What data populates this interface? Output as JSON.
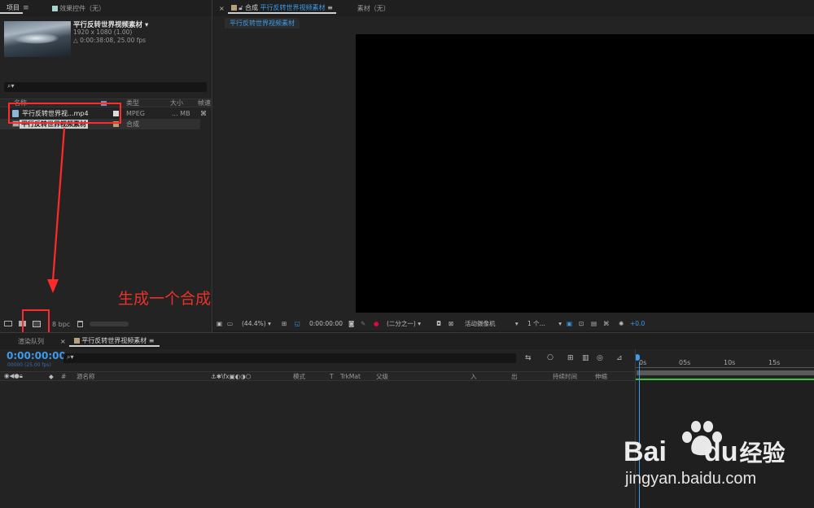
{
  "project_panel": {
    "tab_project": "项目",
    "tab_effects": "效果控件（无）",
    "asset": {
      "name": "平行反转世界视频素材",
      "resolution": "1920 x 1080 (1.00)",
      "duration": "△ 0:00:38:08, 25.00 fps"
    },
    "search_placeholder": "",
    "columns": {
      "name": "名称",
      "type": "类型",
      "size": "大小",
      "frame": "帧速"
    },
    "items": [
      {
        "name": "平行反转世界视...mp4",
        "type": "MPEG",
        "size": "... MB"
      },
      {
        "name": "平行反转世界视频素材",
        "type": "合成",
        "size": ""
      }
    ],
    "bpc": "8 bpc"
  },
  "annotation": {
    "text": "生成一个合成",
    "color": "#e8322a"
  },
  "viewer": {
    "tab_close": "×",
    "tab_comp_prefix": "合成",
    "tab_comp_name": "平行反转世界视频素材",
    "tab_footage": "素材（无）",
    "breadcrumb": "平行反转世界视频素材",
    "zoom": "(44.4%)",
    "timecode": "0:00:00:00",
    "resolution": "(二分之一)",
    "camera": "活动摄像机",
    "views": "1 个...",
    "exposure": "+0.0"
  },
  "timeline": {
    "tab_render": "渲染队列",
    "tab_close": "×",
    "tab_comp": "平行反转世界视频素材",
    "timecode": "0:00:00:00",
    "frame_info": "00000 (25.00 fps)",
    "columns": {
      "hash": "#",
      "source": "源名称",
      "mode": "模式",
      "t": "T",
      "trkmat": "TrkMat",
      "parent": "父级",
      "in": "入",
      "out": "出",
      "duration": "持续时间",
      "stretch": "伸缩"
    },
    "ruler": [
      "0s",
      "05s",
      "10s",
      "15s"
    ]
  },
  "watermark": {
    "brand_a": "Bai",
    "brand_b": "du",
    "brand_c": "经验",
    "url": "jingyan.baidu.com"
  },
  "colors": {
    "accent_blue": "#3d9be9",
    "annotation_red": "#ff2a2a",
    "timeline_green": "#3fc43f"
  }
}
